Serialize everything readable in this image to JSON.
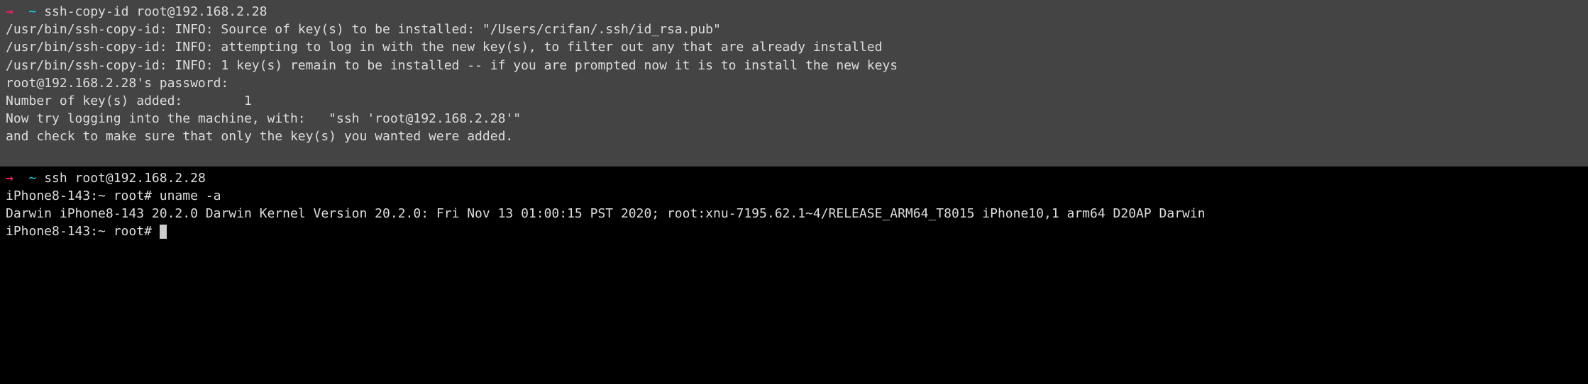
{
  "session1": {
    "prompt_arrow": "→",
    "prompt_tilde": "  ~ ",
    "command": "ssh-copy-id root@192.168.2.28",
    "output_lines": [
      "/usr/bin/ssh-copy-id: INFO: Source of key(s) to be installed: \"/Users/crifan/.ssh/id_rsa.pub\"",
      "/usr/bin/ssh-copy-id: INFO: attempting to log in with the new key(s), to filter out any that are already installed",
      "/usr/bin/ssh-copy-id: INFO: 1 key(s) remain to be installed -- if you are prompted now it is to install the new keys",
      "root@192.168.2.28's password:",
      "",
      "Number of key(s) added:        1",
      "",
      "Now try logging into the machine, with:   \"ssh 'root@192.168.2.28'\"",
      "and check to make sure that only the key(s) you wanted were added.",
      ""
    ]
  },
  "session2": {
    "prompt_arrow": "→",
    "prompt_tilde": "  ~ ",
    "command": "ssh root@192.168.2.28",
    "line1_prompt": "iPhone8-143:~ root# ",
    "line1_command": "uname -a",
    "line2": "Darwin iPhone8-143 20.2.0 Darwin Kernel Version 20.2.0: Fri Nov 13 01:00:15 PST 2020; root:xnu-7195.62.1~4/RELEASE_ARM64_T8015 iPhone10,1 arm64 D20AP Darwin",
    "line3_prompt": "iPhone8-143:~ root# "
  }
}
